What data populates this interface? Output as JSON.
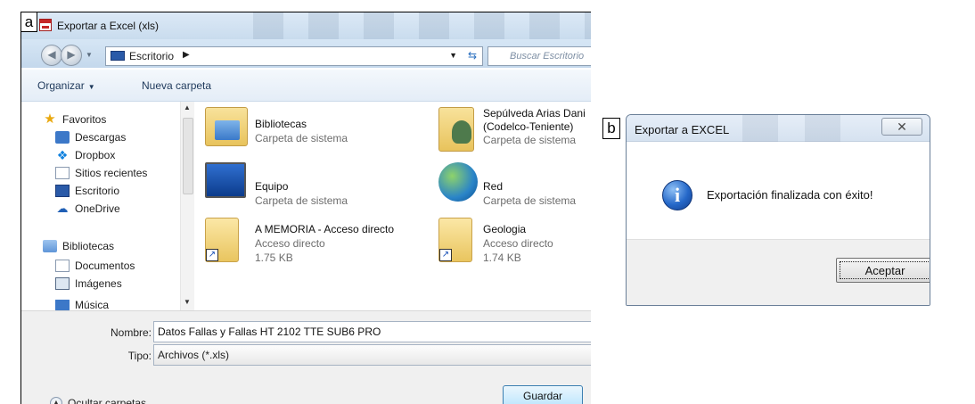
{
  "panel_a": {
    "letter": "a",
    "window_title": "Exportar a Excel (xls)",
    "address": "Escritorio",
    "search_placeholder": "Buscar Escritorio",
    "toolbar": {
      "organize": "Organizar",
      "new_folder": "Nueva carpeta"
    },
    "sidebar": {
      "favorites": "Favoritos",
      "downloads": "Descargas",
      "dropbox": "Dropbox",
      "recent": "Sitios recientes",
      "desktop": "Escritorio",
      "onedrive": "OneDrive",
      "libraries": "Bibliotecas",
      "documents": "Documentos",
      "images": "Imágenes",
      "music_partial": "Música"
    },
    "files": [
      {
        "name": "Bibliotecas",
        "sub1": "Carpeta de sistema",
        "sub2": "",
        "icon": "libraries-folder-icon"
      },
      {
        "name": "Sepúlveda Arias Dani",
        "sub1": "(Codelco-Teniente)",
        "sub2": "Carpeta de sistema",
        "icon": "user-folder-icon"
      },
      {
        "name": "Equipo",
        "sub1": "Carpeta de sistema",
        "sub2": "",
        "icon": "computer-icon"
      },
      {
        "name": "Red",
        "sub1": "Carpeta de sistema",
        "sub2": "",
        "icon": "network-icon"
      },
      {
        "name": "A MEMORIA - Acceso directo",
        "sub1": "Acceso directo",
        "sub2": "1.75 KB",
        "icon": "shortcut-folder-icon"
      },
      {
        "name": "Geologia",
        "sub1": "Acceso directo",
        "sub2": "1.74 KB",
        "icon": "shortcut-folder-icon"
      }
    ],
    "form": {
      "name_label": "Nombre:",
      "name_value": "Datos Fallas y Fallas HT 2102 TTE SUB6 PRO",
      "type_label": "Tipo:",
      "type_value": "Archivos (*.xls)"
    },
    "hide_folders": "Ocultar carpetas",
    "save": "Guardar"
  },
  "panel_b": {
    "letter": "b",
    "title": "Exportar a EXCEL",
    "close_glyph": "✕",
    "message": "Exportación finalizada con éxito!",
    "ok": "Aceptar"
  }
}
